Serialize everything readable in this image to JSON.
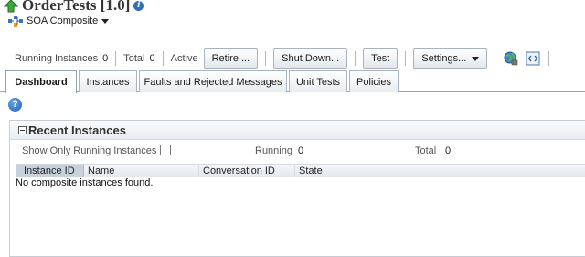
{
  "header": {
    "title": "OrderTests [1.0]",
    "composite_label": "SOA Composite"
  },
  "toolbar": {
    "running_label": "Running Instances",
    "running_value": "0",
    "total_label": "Total",
    "total_value": "0",
    "status": "Active",
    "retire_label": "Retire ...",
    "shutdown_label": "Shut Down...",
    "test_label": "Test",
    "settings_label": "Settings..."
  },
  "tabs": [
    {
      "label": "Dashboard",
      "active": true
    },
    {
      "label": "Instances"
    },
    {
      "label": "Faults and Rejected Messages"
    },
    {
      "label": "Unit Tests"
    },
    {
      "label": "Policies"
    }
  ],
  "help": {
    "glyph": "?"
  },
  "recent": {
    "title": "Recent Instances",
    "show_only_running_label": "Show Only Running Instances",
    "running_label": "Running",
    "running_value": "0",
    "total_label": "Total",
    "total_value": "0",
    "columns": [
      "Instance ID",
      "Name",
      "Conversation ID",
      "State"
    ],
    "empty_message": "No composite instances found."
  },
  "icons": {
    "up": "green-up-arrow-icon",
    "info": "info-icon",
    "composite": "soa-composite-icon",
    "globe": "globe-icon",
    "xml": "xml-source-icon",
    "help": "help-icon"
  },
  "colors": {
    "accent": "#2f6fb7",
    "up_arrow": "#2e9a2e",
    "sorted_column": "#c6d1dc"
  }
}
